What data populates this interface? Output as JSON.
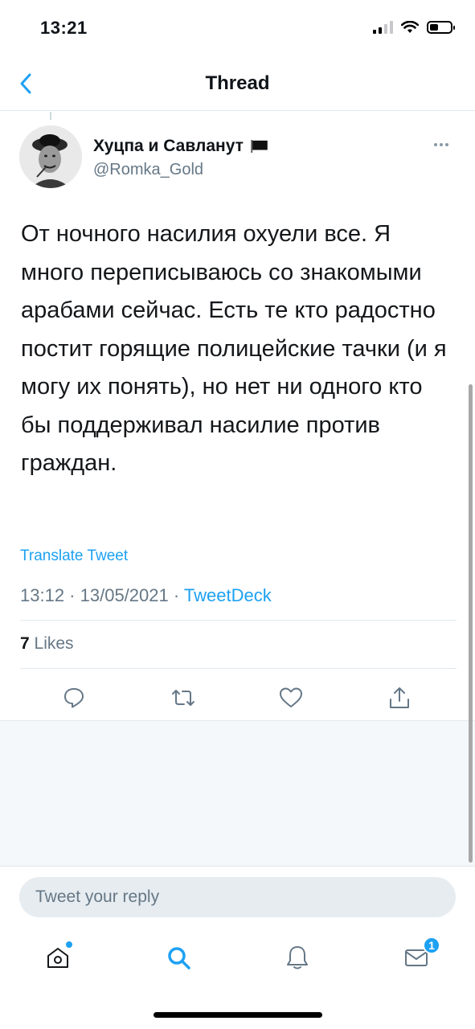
{
  "status_bar": {
    "time": "13:21"
  },
  "nav": {
    "title": "Thread"
  },
  "tweet": {
    "display_name": "Хуцпа и Савланут",
    "username": "@Romka_Gold",
    "text": "От ночного насилия охуели все. Я много переписываюсь со знакомыми арабами сейчас. Есть те кто радостно постит горящие полицейские тачки (и я могу их понять), но нет ни одного кто бы поддерживал насилие против граждан.",
    "translate_label": "Translate Tweet",
    "time": "13:12",
    "date": "13/05/2021",
    "separator": " · ",
    "source": "TweetDeck",
    "likes_count": "7",
    "likes_label": "Likes"
  },
  "reply": {
    "placeholder": "Tweet your reply"
  },
  "tab_bar": {
    "messages_badge": "1"
  },
  "colors": {
    "accent": "#1da1f2",
    "secondary_text": "#657786",
    "divider": "#e1e8ed"
  }
}
